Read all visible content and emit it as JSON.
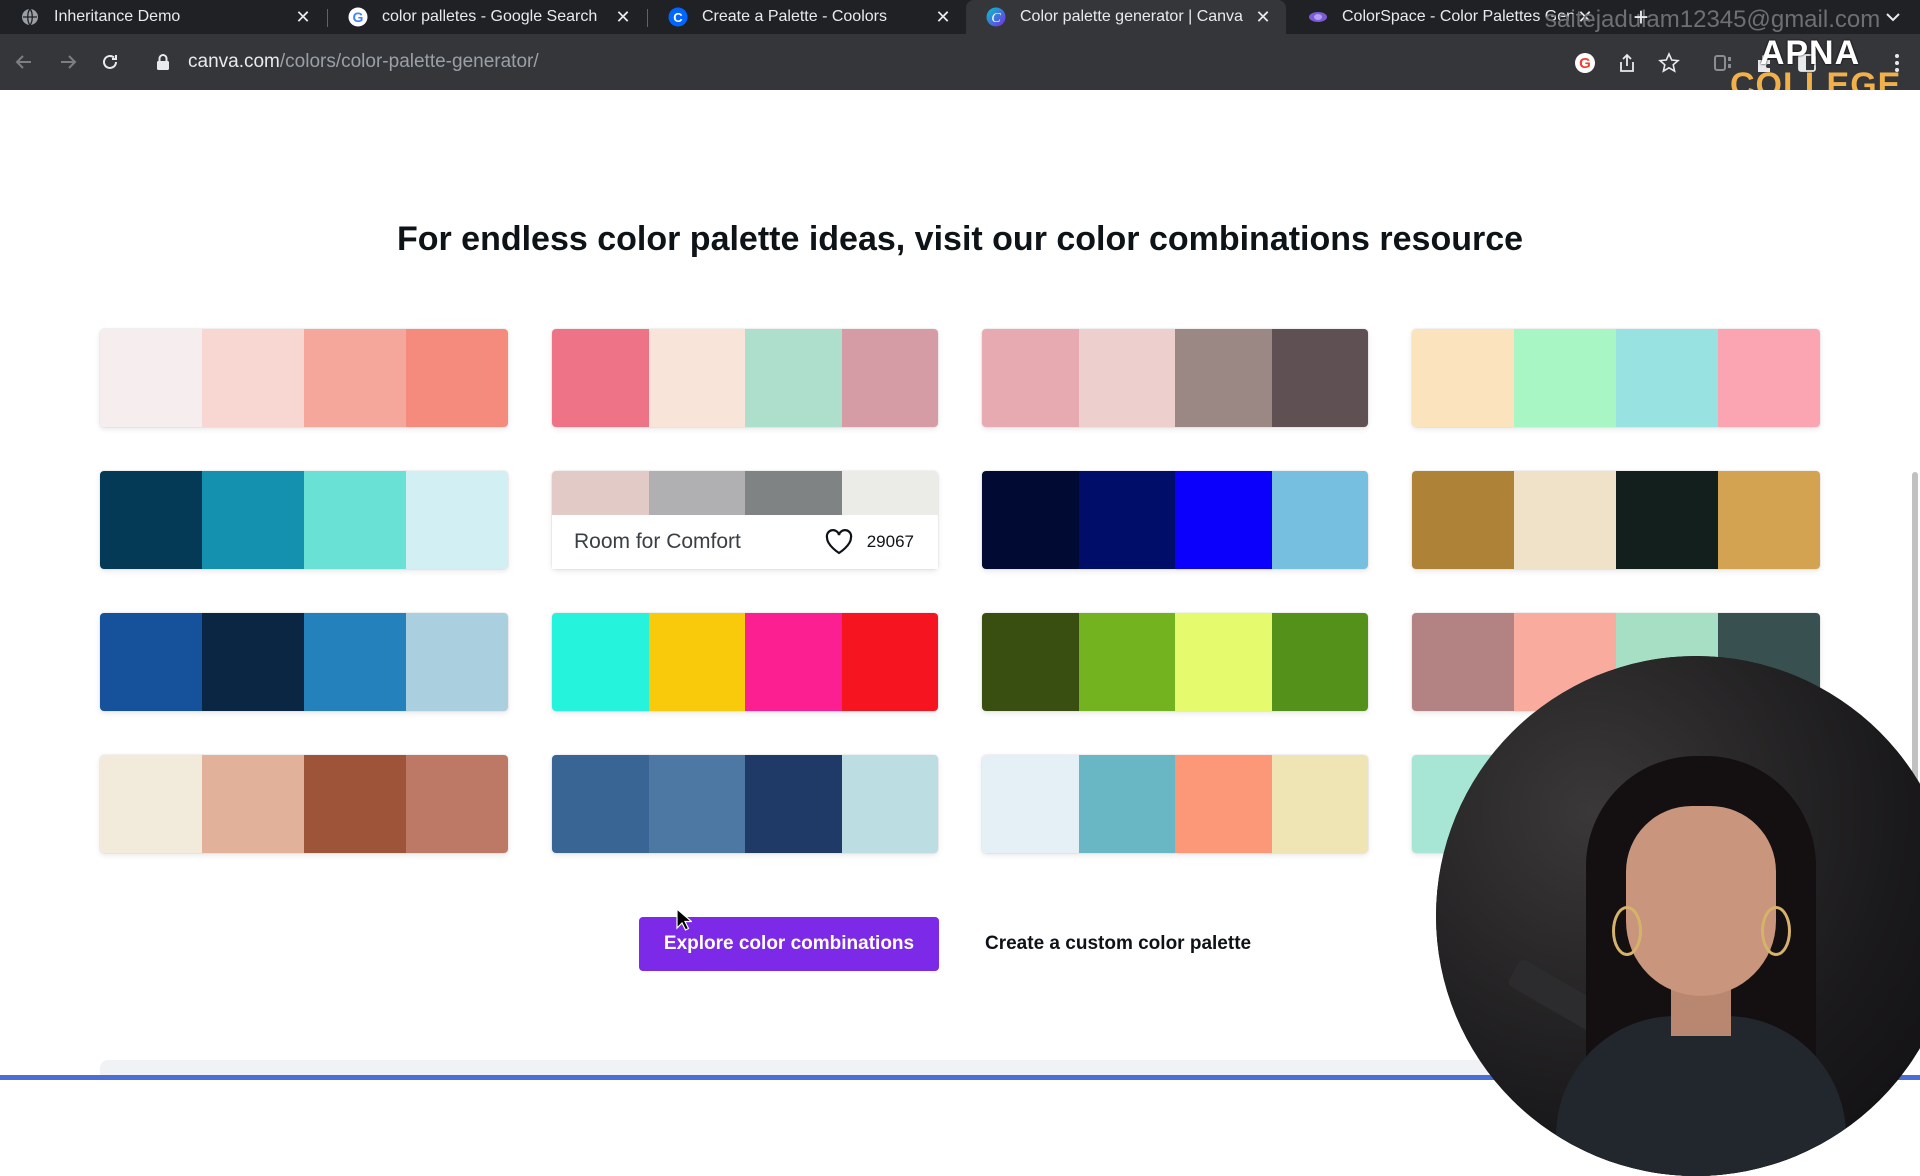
{
  "browser": {
    "tabs": [
      {
        "title": "Inheritance Demo",
        "icon": "globe-icon"
      },
      {
        "title": "color palletes - Google Search",
        "icon": "google-icon"
      },
      {
        "title": "Create a Palette - Coolors",
        "icon": "coolors-icon"
      },
      {
        "title": "Color palette generator | Canva",
        "icon": "canva-icon"
      },
      {
        "title": "ColorSpace - Color Palettes Generator",
        "icon": "colorspace-icon"
      }
    ],
    "account_email": "saitejadulam12345@gmail.com",
    "url_domain": "canva.com",
    "url_path": "/colors/color-palette-generator/"
  },
  "logo": {
    "line1": "APNA",
    "line2": "COLLEGE"
  },
  "page": {
    "heading": "For endless color palette ideas, visit our color combinations resource",
    "palettes": [
      {
        "colors": [
          "#f6eeee",
          "#f8d7d3",
          "#f5a79b",
          "#f48b7d"
        ]
      },
      {
        "colors": [
          "#ee7386",
          "#f9e4da",
          "#aedfcd",
          "#d59ca6"
        ]
      },
      {
        "colors": [
          "#e6aab0",
          "#edcfcd",
          "#9b8783",
          "#5e5053"
        ]
      },
      {
        "colors": [
          "#fbe3bd",
          "#a8f6c4",
          "#98e3e1",
          "#fba5b3"
        ]
      },
      {
        "colors": [
          "#053a57",
          "#1591b0",
          "#69e2d5",
          "#d2eff3"
        ]
      },
      {
        "colors": [
          "#e2cbc6",
          "#b0afb1",
          "#7f8384",
          "#ebebe8"
        ],
        "name": "Room for Comfort",
        "likes": "29067"
      },
      {
        "colors": [
          "#010a32",
          "#000d69",
          "#0a00fb",
          "#76bfe0"
        ]
      },
      {
        "colors": [
          "#af8337",
          "#f0e2c8",
          "#131f1d",
          "#d3a351"
        ]
      },
      {
        "colors": [
          "#16529c",
          "#0b2642",
          "#2581bb",
          "#aacfdf"
        ]
      },
      {
        "colors": [
          "#26f3dc",
          "#f9c90b",
          "#fb1f92",
          "#f5141f"
        ]
      },
      {
        "colors": [
          "#394f12",
          "#74b320",
          "#e6fa6e",
          "#53911b"
        ]
      },
      {
        "colors": [
          "#b38384",
          "#f9ab9d",
          "#a6dfc4",
          "#385150"
        ]
      },
      {
        "colors": [
          "#f2eadb",
          "#e2b19a",
          "#9e5438",
          "#be7966"
        ]
      },
      {
        "colors": [
          "#386593",
          "#4d78a4",
          "#203a68",
          "#bcdde2"
        ]
      },
      {
        "colors": [
          "#e5f0f6",
          "#69b6c5",
          "#fc9877",
          "#efe4b3"
        ]
      },
      {
        "colors": [
          "#a7e6d4",
          "#d9f2ea",
          "#f2d5c9",
          "#e9a58d"
        ]
      }
    ],
    "explore_button": "Explore color combinations",
    "custom_link": "Create a custom color palette"
  },
  "colors": {
    "accent": "#7d2ae8",
    "chrome_dark": "#202124",
    "chrome_toolbar": "#35363a"
  }
}
